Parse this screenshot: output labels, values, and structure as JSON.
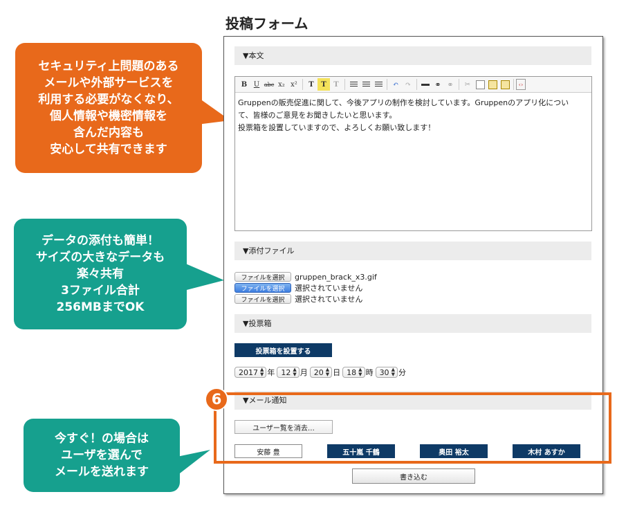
{
  "page_title": "投稿フォーム",
  "sections": {
    "body": "▼本文",
    "attachments": "▼添付ファイル",
    "ballot": "▼投票箱",
    "mail": "▼メール通知"
  },
  "editor": {
    "toolbar": [
      {
        "label": "B",
        "icon": "bold-icon"
      },
      {
        "label": "U",
        "icon": "underline-icon"
      },
      {
        "label": "abc",
        "icon": "strikethrough-icon"
      },
      {
        "label": "x₂",
        "icon": "subscript-icon"
      },
      {
        "label": "x²",
        "icon": "superscript-icon"
      },
      {
        "label": "T",
        "icon": "text-color-icon"
      },
      {
        "label": "T",
        "icon": "background-color-icon"
      },
      {
        "label": "T",
        "icon": "remove-format-icon"
      },
      {
        "label": "",
        "icon": "align-left-icon"
      },
      {
        "label": "",
        "icon": "align-center-icon"
      },
      {
        "label": "",
        "icon": "align-right-icon"
      },
      {
        "label": "↶",
        "icon": "undo-icon"
      },
      {
        "label": "↷",
        "icon": "redo-icon"
      },
      {
        "label": "",
        "icon": "horizontal-rule-icon"
      },
      {
        "label": "",
        "icon": "link-icon"
      },
      {
        "label": "",
        "icon": "unlink-icon"
      },
      {
        "label": "✂",
        "icon": "cut-icon"
      },
      {
        "label": "",
        "icon": "copy-icon"
      },
      {
        "label": "",
        "icon": "paste-icon"
      },
      {
        "label": "",
        "icon": "paste-word-icon"
      },
      {
        "label": "‹›",
        "icon": "source-icon"
      }
    ],
    "content_lines": [
      "Gruppenの販売促進に関して、今後アプリの制作を検討しています。Gruppenのアプリ化につい",
      "て、皆様のご意見をお聞きしたいと思います。",
      "投票箱を設置していますので、よろしくお願い致します！"
    ]
  },
  "files": [
    {
      "button": "ファイルを選択",
      "status": "gruppen_brack_x3.gif",
      "active": false
    },
    {
      "button": "ファイルを選択",
      "status": "選択されていません",
      "active": true
    },
    {
      "button": "ファイルを選択",
      "status": "選択されていません",
      "active": false
    }
  ],
  "ballot_button": "投票箱を設置する",
  "date": {
    "year": "2017",
    "year_unit": "年",
    "month": "12",
    "month_unit": "月",
    "day": "20",
    "day_unit": "日",
    "hour": "18",
    "hour_unit": "時",
    "minute": "30",
    "minute_unit": "分"
  },
  "clear_users_button": "ユーザー覧を消去…",
  "users": [
    {
      "name": "安藤 豊",
      "selected": false
    },
    {
      "name": "五十嵐 千鶴",
      "selected": true
    },
    {
      "name": "奥田 裕太",
      "selected": true
    },
    {
      "name": "木村 あすか",
      "selected": true
    }
  ],
  "submit_button": "書き込む",
  "step_number": "6",
  "callouts": [
    {
      "text": "セキュリティ上問題のある\nメールや外部サービスを\n利用する必要がなくなり、\n個人情報や機密情報を\n含んだ内容も\n安心して共有できます"
    },
    {
      "text": "データの添付も簡単！\nサイズの大きなデータも\n楽々共有\n3ファイル合計\n256MBまでOK"
    },
    {
      "text": "今すぐ！の場合は\nユーザを選んで\nメールを送れます"
    }
  ],
  "colors": {
    "accent_orange": "#e8691b",
    "callout_teal": "#16a08e",
    "navy": "#0e3a66"
  }
}
